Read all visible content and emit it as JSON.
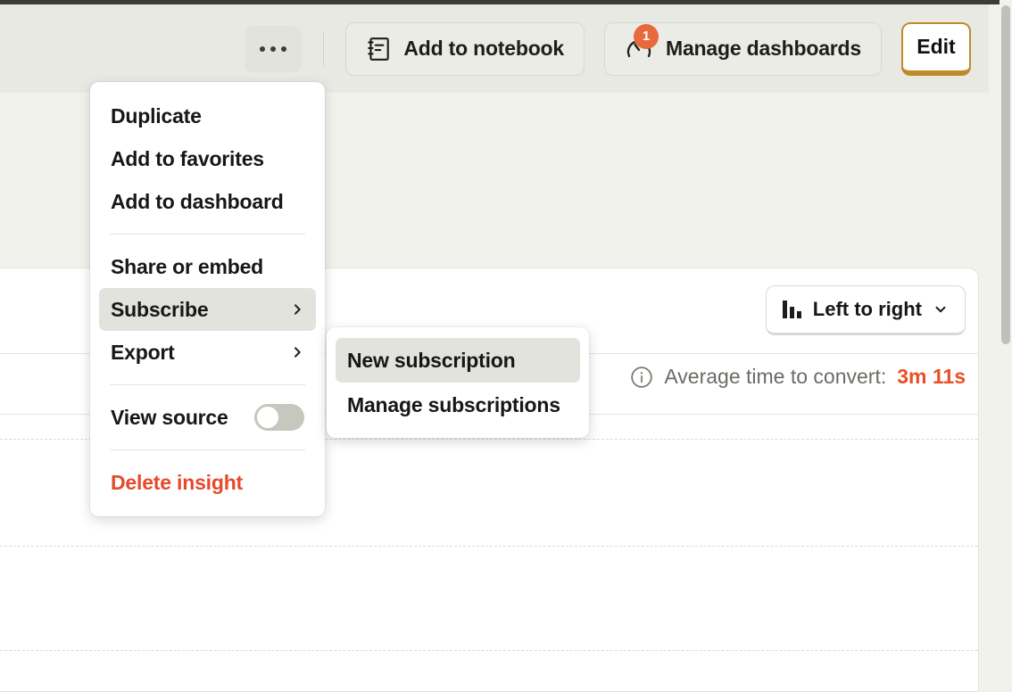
{
  "header": {
    "kebab_button": {
      "name": "more-options",
      "dots": "···"
    },
    "add_to_notebook_label": "Add to notebook",
    "manage_dashboards_label": "Manage dashboards",
    "manage_dashboards_badge": "1",
    "edit_label": "Edit"
  },
  "card": {
    "chart_type_selector": {
      "label": "Left to right",
      "icon": "bar-chart-icon",
      "chevron": "chevron-down-icon"
    },
    "average_time": {
      "icon": "info-icon",
      "label": "Average time to convert:",
      "value": "3m 11s",
      "value_color": "#ea4f27"
    }
  },
  "menu": {
    "items": [
      {
        "label": "Duplicate",
        "type": "item"
      },
      {
        "label": "Add to favorites",
        "type": "item"
      },
      {
        "label": "Add to dashboard",
        "type": "item"
      },
      {
        "label": "Share or embed",
        "type": "item"
      },
      {
        "label": "Subscribe",
        "type": "submenu",
        "highlighted": true
      },
      {
        "label": "Export",
        "type": "submenu"
      },
      {
        "label": "View source",
        "type": "toggle",
        "toggle_on": false
      },
      {
        "label": "Delete insight",
        "type": "danger"
      }
    ]
  },
  "submenu": {
    "items": [
      {
        "label": "New subscription",
        "highlighted": true
      },
      {
        "label": "Manage subscriptions",
        "highlighted": false
      }
    ]
  },
  "colors": {
    "accent_orange": "#ea4f27",
    "edit_border": "#c08a2a",
    "header_bg": "#e9e9e4",
    "page_bg": "#f2f2ed",
    "card_bg": "#ffffff"
  }
}
